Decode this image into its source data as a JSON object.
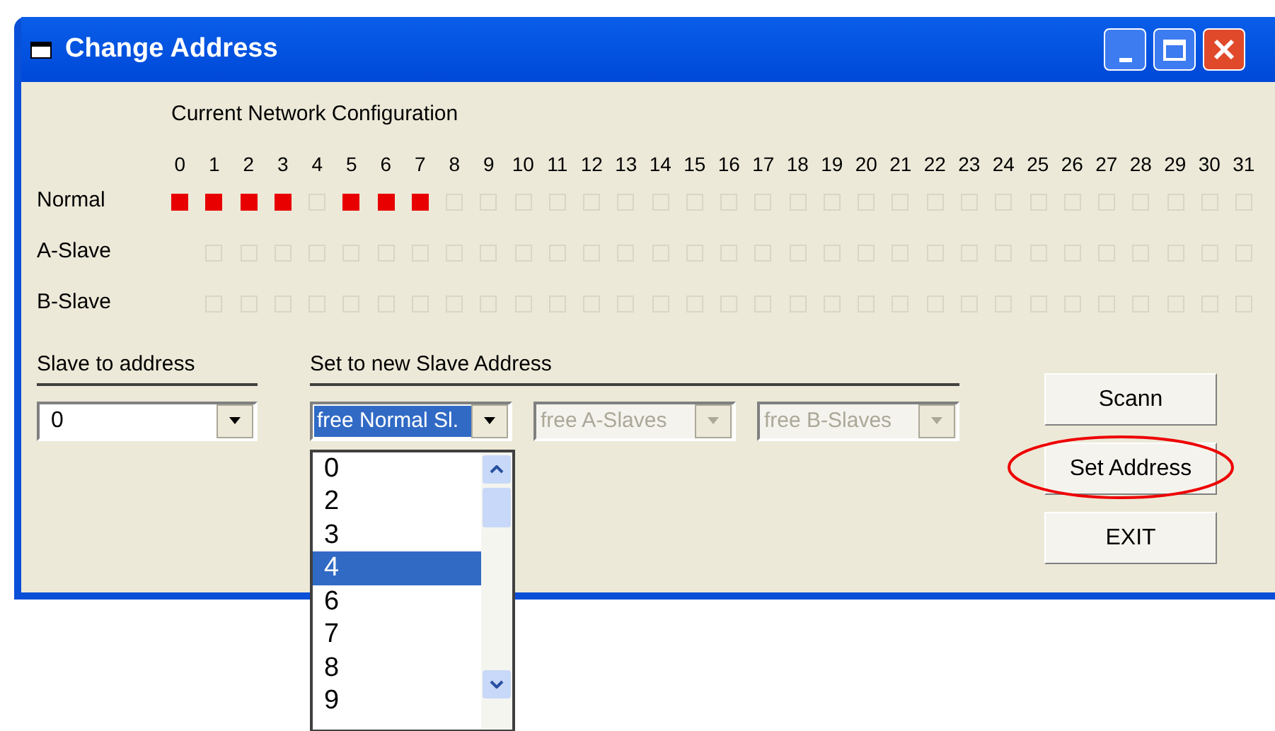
{
  "window": {
    "title": "Change Address"
  },
  "config": {
    "heading": "Current Network Configuration",
    "addresses": [
      "0",
      "1",
      "2",
      "3",
      "4",
      "5",
      "6",
      "7",
      "8",
      "9",
      "10",
      "11",
      "12",
      "13",
      "14",
      "15",
      "16",
      "17",
      "18",
      "19",
      "20",
      "21",
      "22",
      "23",
      "24",
      "25",
      "26",
      "27",
      "28",
      "29",
      "30",
      "31"
    ],
    "rows": [
      {
        "label": "Normal",
        "cells": [
          {
            "occupied": true
          },
          {
            "occupied": true
          },
          {
            "occupied": true
          },
          {
            "occupied": true
          },
          {
            "occupied": false
          },
          {
            "occupied": true
          },
          {
            "occupied": true
          },
          {
            "occupied": true
          },
          {
            "occupied": false
          },
          {
            "occupied": false
          },
          {
            "occupied": false
          },
          {
            "occupied": false
          },
          {
            "occupied": false
          },
          {
            "occupied": false
          },
          {
            "occupied": false
          },
          {
            "occupied": false
          },
          {
            "occupied": false
          },
          {
            "occupied": false
          },
          {
            "occupied": false
          },
          {
            "occupied": false
          },
          {
            "occupied": false
          },
          {
            "occupied": false
          },
          {
            "occupied": false
          },
          {
            "occupied": false
          },
          {
            "occupied": false
          },
          {
            "occupied": false
          },
          {
            "occupied": false
          },
          {
            "occupied": false
          },
          {
            "occupied": false
          },
          {
            "occupied": false
          },
          {
            "occupied": false
          },
          {
            "occupied": false
          }
        ]
      },
      {
        "label": "A-Slave",
        "cells": [
          {
            "occupied": false
          },
          {
            "occupied": false
          },
          {
            "occupied": false
          },
          {
            "occupied": false
          },
          {
            "occupied": false
          },
          {
            "occupied": false
          },
          {
            "occupied": false
          },
          {
            "occupied": false
          },
          {
            "occupied": false
          },
          {
            "occupied": false
          },
          {
            "occupied": false
          },
          {
            "occupied": false
          },
          {
            "occupied": false
          },
          {
            "occupied": false
          },
          {
            "occupied": false
          },
          {
            "occupied": false
          },
          {
            "occupied": false
          },
          {
            "occupied": false
          },
          {
            "occupied": false
          },
          {
            "occupied": false
          },
          {
            "occupied": false
          },
          {
            "occupied": false
          },
          {
            "occupied": false
          },
          {
            "occupied": false
          },
          {
            "occupied": false
          },
          {
            "occupied": false
          },
          {
            "occupied": false
          },
          {
            "occupied": false
          },
          {
            "occupied": false
          },
          {
            "occupied": false
          },
          {
            "occupied": false
          }
        ]
      },
      {
        "label": "B-Slave",
        "cells": [
          {
            "occupied": false
          },
          {
            "occupied": false
          },
          {
            "occupied": false
          },
          {
            "occupied": false
          },
          {
            "occupied": false
          },
          {
            "occupied": false
          },
          {
            "occupied": false
          },
          {
            "occupied": false
          },
          {
            "occupied": false
          },
          {
            "occupied": false
          },
          {
            "occupied": false
          },
          {
            "occupied": false
          },
          {
            "occupied": false
          },
          {
            "occupied": false
          },
          {
            "occupied": false
          },
          {
            "occupied": false
          },
          {
            "occupied": false
          },
          {
            "occupied": false
          },
          {
            "occupied": false
          },
          {
            "occupied": false
          },
          {
            "occupied": false
          },
          {
            "occupied": false
          },
          {
            "occupied": false
          },
          {
            "occupied": false
          },
          {
            "occupied": false
          },
          {
            "occupied": false
          },
          {
            "occupied": false
          },
          {
            "occupied": false
          },
          {
            "occupied": false
          },
          {
            "occupied": false
          },
          {
            "occupied": false
          }
        ]
      }
    ]
  },
  "slave_to_address": {
    "label": "Slave to address",
    "value": "0"
  },
  "new_address": {
    "label": "Set to new Slave Address",
    "combos": [
      {
        "value": "free Normal Sl.",
        "disabled": false,
        "highlighted": true
      },
      {
        "value": "free A-Slaves",
        "disabled": true,
        "highlighted": false
      },
      {
        "value": "free B-Slaves",
        "disabled": true,
        "highlighted": false
      }
    ],
    "dropdown": [
      {
        "label": "0",
        "selected": false
      },
      {
        "label": "2",
        "selected": false
      },
      {
        "label": "3",
        "selected": false
      },
      {
        "label": "4",
        "selected": true
      },
      {
        "label": "6",
        "selected": false
      },
      {
        "label": "7",
        "selected": false
      },
      {
        "label": "8",
        "selected": false
      },
      {
        "label": "9",
        "selected": false
      }
    ]
  },
  "buttons": [
    {
      "label": "Scann",
      "circled": false
    },
    {
      "label": "Set Address",
      "circled": true
    },
    {
      "label": "EXIT",
      "circled": false
    }
  ]
}
